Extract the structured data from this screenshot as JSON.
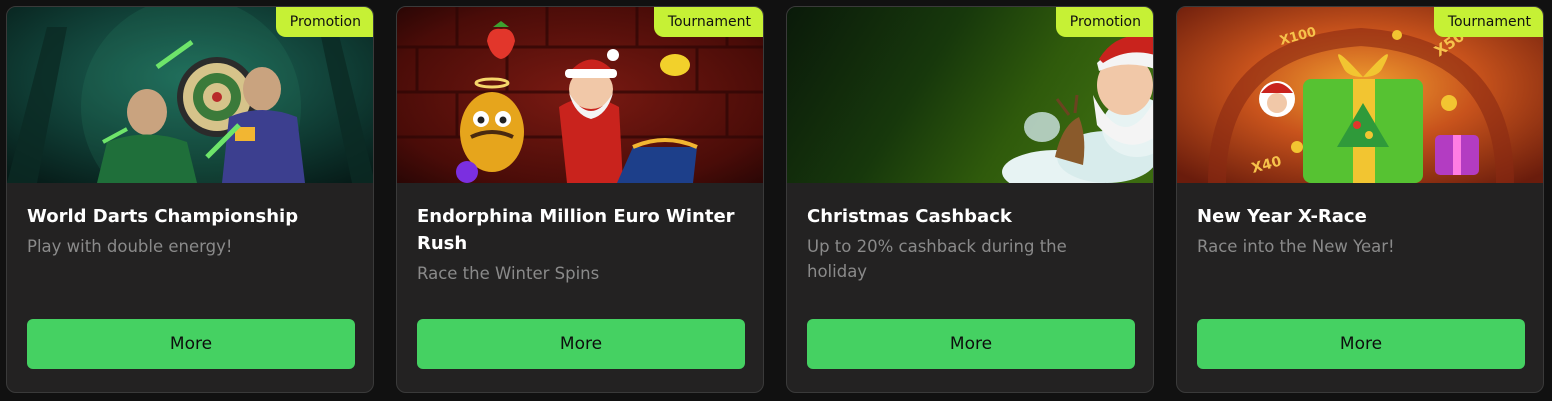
{
  "cards": [
    {
      "badge": "Promotion",
      "title": "World Darts Championship",
      "subtitle": "Play with double energy!",
      "button_label": "More"
    },
    {
      "badge": "Tournament",
      "title": "Endorphina Million Euro Winter Rush",
      "subtitle": "Race the Winter Spins",
      "button_label": "More"
    },
    {
      "badge": "Promotion",
      "title": "Christmas Cashback",
      "subtitle": "Up to 20% cashback during the holiday",
      "button_label": "More"
    },
    {
      "badge": "Tournament",
      "title": "New Year X-Race",
      "subtitle": "Race into the New Year!",
      "button_label": "More"
    }
  ],
  "banner_multipliers": [
    "X100",
    "X500",
    "X40"
  ],
  "colors": {
    "page_background": "#111111",
    "card_background": "#232222",
    "badge": "#c6f135",
    "button": "#45d162",
    "title_text": "#ffffff",
    "subtitle_text": "#8a8a8a"
  }
}
